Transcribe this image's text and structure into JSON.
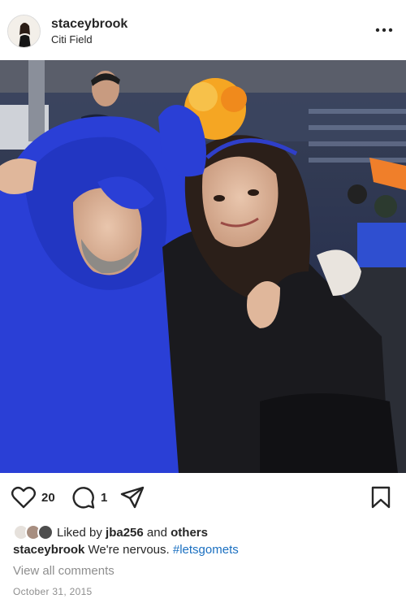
{
  "post": {
    "username": "staceybrook",
    "location": "Citi Field",
    "more_icon": "more-options-icon"
  },
  "photo": {
    "description_icon": "photo",
    "colors": {
      "jacket": "#2a3fd6",
      "coat": "#1a1a1e",
      "sky": "#1f2a44",
      "pompom_orange": "#f5a623"
    }
  },
  "actions": {
    "like_icon": "heart-icon",
    "like_count": "20",
    "comment_icon": "comment-icon",
    "comment_count": "1",
    "share_icon": "share-icon",
    "save_icon": "bookmark-icon"
  },
  "likes": {
    "prefix": "Liked by",
    "user": "jba256",
    "and": "and",
    "others": "others"
  },
  "caption": {
    "username": "staceybrook",
    "text": "We're nervous.",
    "hashtag": "#letsgomets"
  },
  "view_all_comments": "View all comments",
  "date": "October 31, 2015"
}
